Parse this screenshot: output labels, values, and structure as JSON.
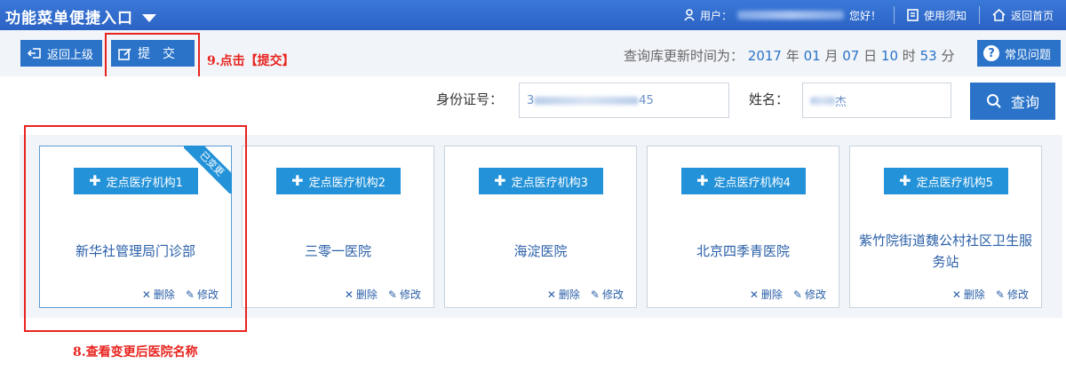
{
  "topbar": {
    "title": "功能菜单便捷入口",
    "user_label": "用户：",
    "user_greeting": "您好！",
    "guide_label": "使用须知",
    "home_label": "返回首页"
  },
  "toolbar": {
    "back_label": "返回上级",
    "submit_label": "提　交",
    "update_prefix": "查询库更新时间为：",
    "update_year": "2017",
    "update_year_unit": "年",
    "update_month": "01",
    "update_month_unit": "月",
    "update_day": "07",
    "update_day_unit": "日",
    "update_hour": "10",
    "update_hour_unit": "时",
    "update_minute": "53",
    "update_minute_unit": "分",
    "faq_label": "常见问题"
  },
  "search": {
    "id_label": "身份证号：",
    "id_value_start": "3",
    "id_value_end": "45",
    "name_label": "姓名：",
    "name_value_start": "",
    "name_value_end": "杰",
    "query_label": "查询"
  },
  "annotations": {
    "step9": "9.点击【提交】",
    "step8": "8.查看变更后医院名称"
  },
  "cards": [
    {
      "tag": "定点医疗机构1",
      "name": "新华社管理局门诊部",
      "changed": true,
      "ribbon": "已变更",
      "delete": "删除",
      "edit": "修改"
    },
    {
      "tag": "定点医疗机构2",
      "name": "三零一医院",
      "delete": "删除",
      "edit": "修改"
    },
    {
      "tag": "定点医疗机构3",
      "name": "海淀医院",
      "delete": "删除",
      "edit": "修改"
    },
    {
      "tag": "定点医疗机构4",
      "name": "北京四季青医院",
      "delete": "删除",
      "edit": "修改"
    },
    {
      "tag": "定点医疗机构5",
      "name": "紫竹院街道魏公村社区卫生服务站",
      "delete": "删除",
      "edit": "修改"
    }
  ],
  "colors": {
    "primary": "#2a73c9",
    "tag": "#2392d8",
    "annotation": "#e8241f"
  }
}
